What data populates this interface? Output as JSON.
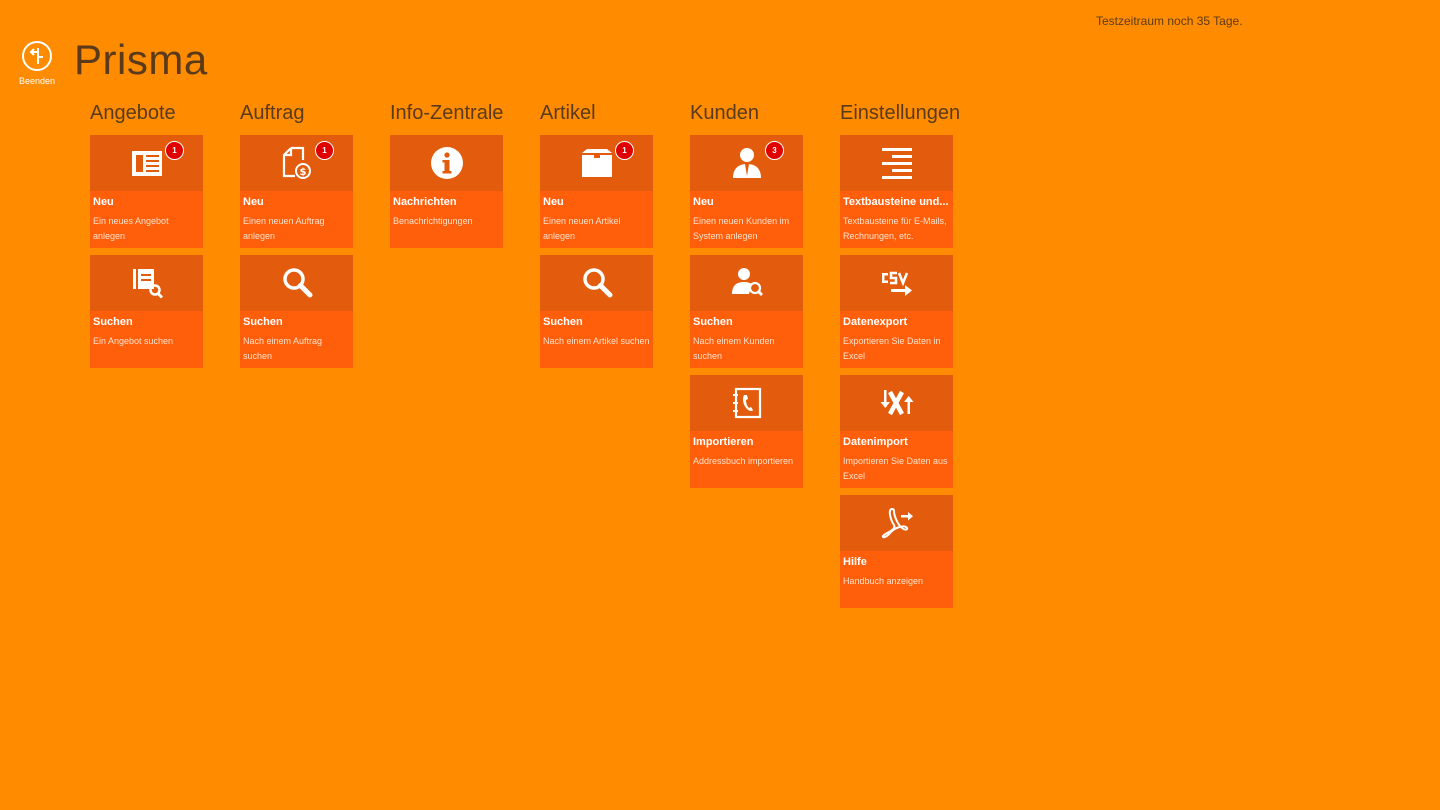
{
  "trial_text": "Testzeitraum noch 35 Tage.",
  "app_title": "Prisma",
  "back": {
    "label": "Beenden",
    "icon": "exit-icon"
  },
  "colors": {
    "background": "#FF8C00",
    "tile": "#FF5E0B",
    "tile_icon_area": "#E35B0C",
    "badge": "#E00000"
  },
  "groups": [
    {
      "title": "Angebote",
      "tiles": [
        {
          "title": "Neu",
          "desc": "Ein neues Angebot anlegen",
          "badge": "1",
          "icon": "new-offer-icon"
        },
        {
          "title": "Suchen",
          "desc": "Ein Angebot suchen",
          "badge": "",
          "icon": "search-offer-icon"
        }
      ]
    },
    {
      "title": "Auftrag",
      "tiles": [
        {
          "title": "Neu",
          "desc": "Einen neuen Auftrag anlegen",
          "badge": "1",
          "icon": "new-order-icon"
        },
        {
          "title": "Suchen",
          "desc": "Nach einem Auftrag suchen",
          "badge": "",
          "icon": "search-icon"
        }
      ]
    },
    {
      "title": "Info-Zentrale",
      "tiles": [
        {
          "title": "Nachrichten",
          "desc": "Benachrichtigungen",
          "badge": "",
          "icon": "info-icon"
        }
      ]
    },
    {
      "title": "Artikel",
      "tiles": [
        {
          "title": "Neu",
          "desc": "Einen neuen Artikel anlegen",
          "badge": "1",
          "icon": "box-icon"
        },
        {
          "title": "Suchen",
          "desc": "Nach einem Artikel suchen",
          "badge": "",
          "icon": "search-icon"
        }
      ]
    },
    {
      "title": "Kunden",
      "tiles": [
        {
          "title": "Neu",
          "desc": "Einen neuen Kunden im System anlegen",
          "badge": "3",
          "icon": "customer-icon"
        },
        {
          "title": "Suchen",
          "desc": "Nach einem Kunden suchen",
          "badge": "",
          "icon": "search-customer-icon"
        },
        {
          "title": "Importieren",
          "desc": "Addressbuch importieren",
          "badge": "",
          "icon": "addressbook-icon"
        }
      ]
    },
    {
      "title": "Einstellungen",
      "tiles": [
        {
          "title": "Textbausteine und...",
          "desc": "Textbausteine für E-Mails, Rechnungen, etc.",
          "badge": "",
          "icon": "text-lines-icon"
        },
        {
          "title": "Datenexport",
          "desc": "Exportieren Sie Daten in Excel",
          "badge": "",
          "icon": "csv-export-icon"
        },
        {
          "title": "Datenimport",
          "desc": "Importieren Sie Daten aus Excel",
          "badge": "",
          "icon": "excel-import-icon"
        },
        {
          "title": "Hilfe",
          "desc": "Handbuch anzeigen",
          "badge": "",
          "icon": "pdf-icon"
        }
      ]
    }
  ]
}
